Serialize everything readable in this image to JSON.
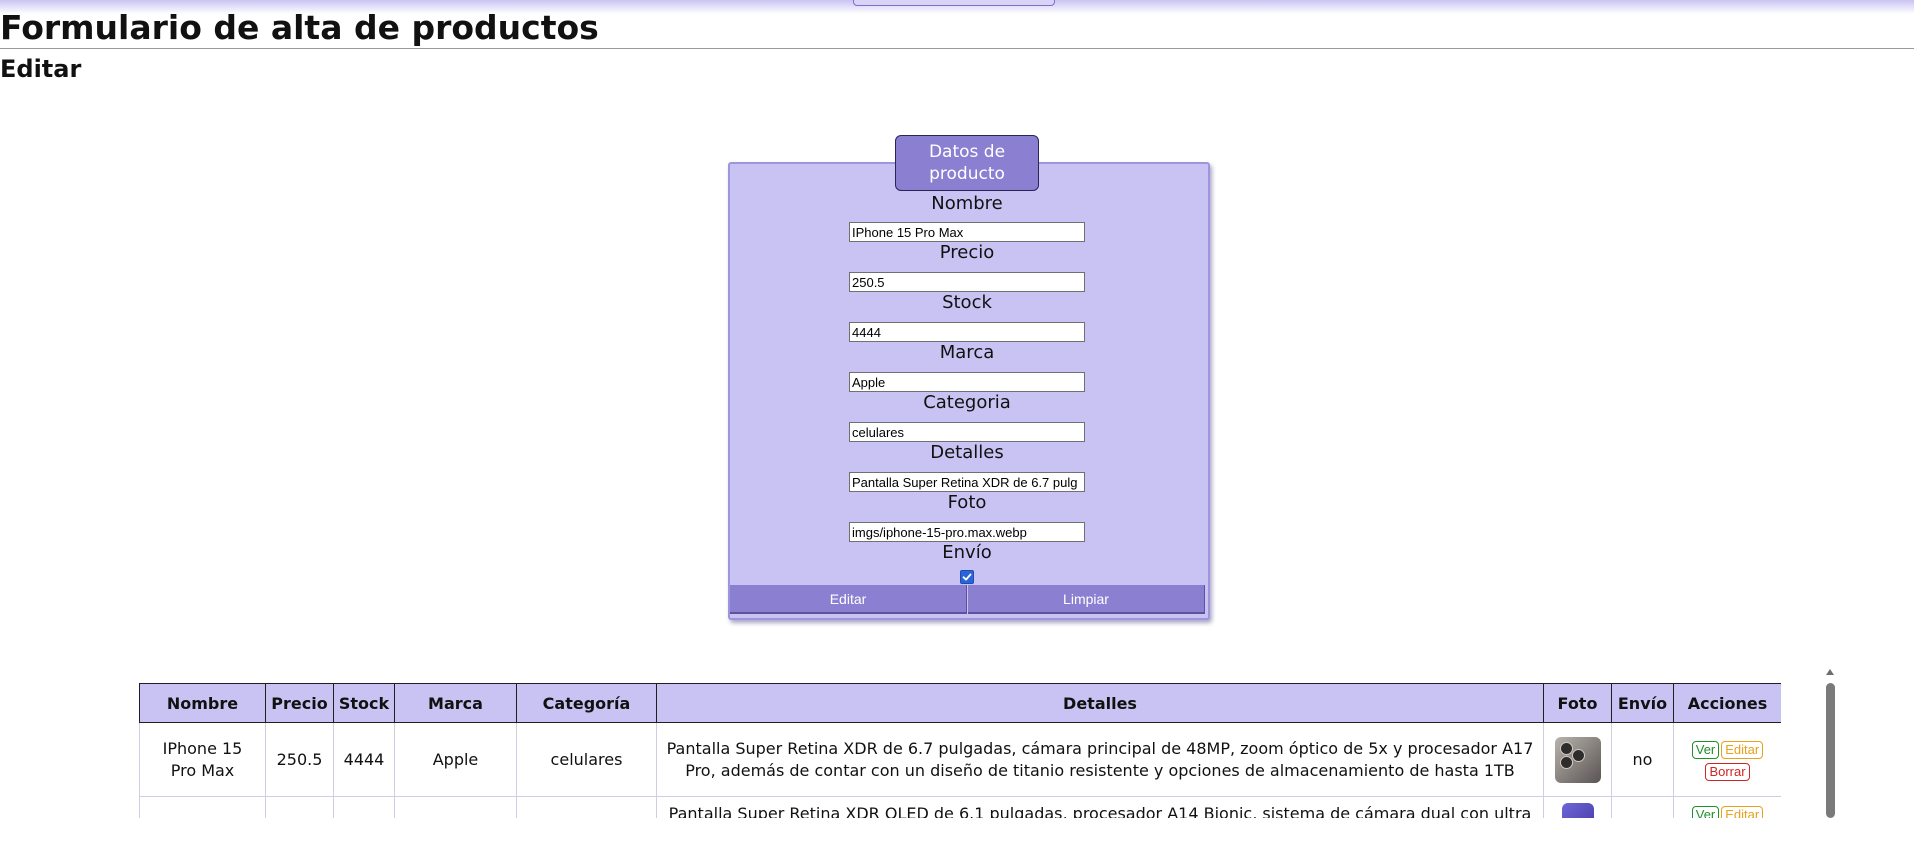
{
  "page": {
    "title": "Formulario de alta de productos",
    "section": "Editar"
  },
  "form": {
    "legend": "Datos de producto",
    "fields": {
      "nombre": {
        "label": "Nombre",
        "value": "IPhone 15 Pro Max"
      },
      "precio": {
        "label": "Precio",
        "value": "250.5"
      },
      "stock": {
        "label": "Stock",
        "value": "4444"
      },
      "marca": {
        "label": "Marca",
        "value": "Apple"
      },
      "categoria": {
        "label": "Categoria",
        "value": "celulares"
      },
      "detalles": {
        "label": "Detalles",
        "value": "Pantalla Super Retina XDR de 6.7 pulg"
      },
      "foto": {
        "label": "Foto",
        "value": "imgs/iphone-15-pro.max.webp"
      },
      "envio": {
        "label": "Envío",
        "checked": true
      }
    },
    "buttons": {
      "edit": "Editar",
      "clear": "Limpiar"
    }
  },
  "table": {
    "headers": [
      "Nombre",
      "Precio",
      "Stock",
      "Marca",
      "Categoría",
      "Detalles",
      "Foto",
      "Envío",
      "Acciones"
    ],
    "rows": [
      {
        "nombre": "IPhone 15 Pro Max",
        "precio": "250.5",
        "stock": "4444",
        "marca": "Apple",
        "categoria": "celulares",
        "detalles": "Pantalla Super Retina XDR de 6.7 pulgadas, cámara principal de 48MP, zoom óptico de 5x y procesador A17 Pro, además de contar con un diseño de titanio resistente y opciones de almacenamiento de hasta 1TB",
        "envio": "no"
      },
      {
        "nombre": "",
        "precio": "",
        "stock": "",
        "marca": "",
        "categoria": "",
        "detalles": "Pantalla Super Retina XDR OLED de 6.1 pulgadas, procesador A14 Bionic, sistema de cámara dual con ultra gran angular",
        "envio": ""
      }
    ],
    "actions": {
      "view": "Ver",
      "edit": "Editar",
      "delete": "Borrar"
    }
  },
  "colors": {
    "panel": "#c9c3f4",
    "accent": "#8b7fd1",
    "view": "#1f8f2a",
    "edit": "#e6a21a",
    "delete": "#d12424"
  }
}
